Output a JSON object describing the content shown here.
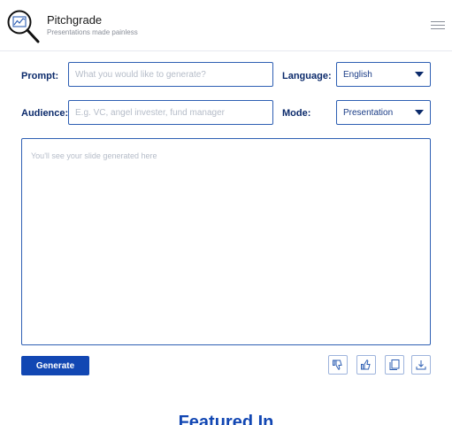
{
  "brand": {
    "name": "Pitchgrade",
    "tagline": "Presentations made painless"
  },
  "form": {
    "prompt_label": "Prompt:",
    "prompt_placeholder": "What you would like to generate?",
    "language_label": "Language:",
    "language_value": "English",
    "audience_label": "Audience:",
    "audience_placeholder": "E.g. VC, angel invester, fund manager",
    "mode_label": "Mode:",
    "mode_value": "Presentation"
  },
  "output": {
    "placeholder": "You'll see your slide generated here"
  },
  "actions": {
    "generate_label": "Generate",
    "icons": [
      "thumbs-down-icon",
      "thumbs-up-icon",
      "copy-icon",
      "download-icon"
    ]
  },
  "featured": {
    "heading": "Featured In"
  },
  "colors": {
    "accent": "#1247b3",
    "border": "#2e5fb3",
    "text_dark": "#0b2a6b"
  }
}
